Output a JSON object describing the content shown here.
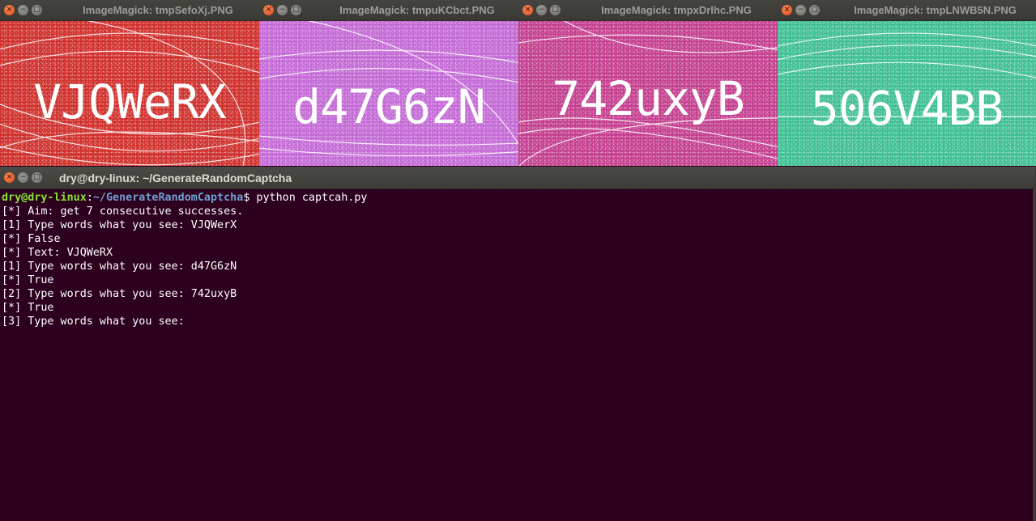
{
  "image_windows": [
    {
      "title": "ImageMagick: tmpSefoXj.PNG",
      "captcha_text": "VJQWeRX",
      "background": "#d0312d"
    },
    {
      "title": "ImageMagick: tmpuKCbct.PNG",
      "captcha_text": "d47G6zN",
      "background": "#c46ad6"
    },
    {
      "title": "ImageMagick: tmpxDrlhc.PNG",
      "captcha_text": "742uxyB",
      "background": "#c4408f"
    },
    {
      "title": "ImageMagick: tmpLNWB5N.PNG",
      "captcha_text": "506V4BB",
      "background": "#3fbf93"
    }
  ],
  "window_controls": {
    "close_icon": "close-icon",
    "minimize_icon": "minimize-icon",
    "maximize_icon": "maximize-icon"
  },
  "terminal": {
    "title": "dry@dry-linux: ~/GenerateRandomCaptcha",
    "prompt": {
      "user_host": "dry@dry-linux",
      "separator": ":",
      "path": "~/GenerateRandomCaptcha",
      "symbol": "$",
      "command": " python captcah.py"
    },
    "lines": [
      "[*] Aim: get 7 consecutive successes.",
      "[1] Type words what you see: VJQWerX",
      "[*] False",
      "[*] Text: VJQWeRX",
      "[1] Type words what you see: d47G6zN",
      "[*] True",
      "[2] Type words what you see: 742uxyB",
      "[*] True",
      "[3] Type words what you see: "
    ],
    "colors": {
      "background": "#2c001e",
      "user_host": "#8ae234",
      "path": "#729fcf",
      "text": "#ffffff"
    }
  }
}
